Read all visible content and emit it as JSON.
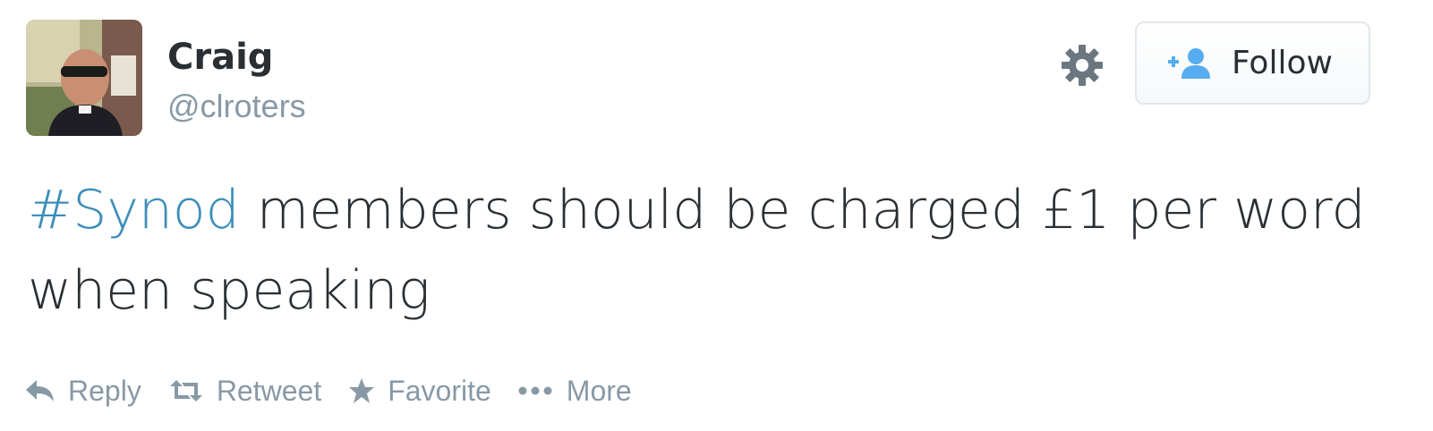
{
  "tweet": {
    "user": {
      "name": "Craig",
      "handle": "@clroters",
      "avatar": "profile-photo"
    },
    "follow_button": {
      "label": "Follow",
      "icon": "add-user-icon"
    },
    "settings_icon": "gear-icon",
    "text": {
      "hashtag": "#Synod",
      "body": " members should be charged £1 per word when speaking"
    },
    "actions": [
      {
        "label": "Reply",
        "icon": "reply-icon"
      },
      {
        "label": "Retweet",
        "icon": "retweet-icon"
      },
      {
        "label": "Favorite",
        "icon": "star-icon"
      },
      {
        "label": "More",
        "icon": "more-icon"
      }
    ],
    "colors": {
      "text": "#292f33",
      "muted": "#8899a6",
      "link": "#3d8eb9",
      "follow_icon": "#55acee"
    }
  }
}
